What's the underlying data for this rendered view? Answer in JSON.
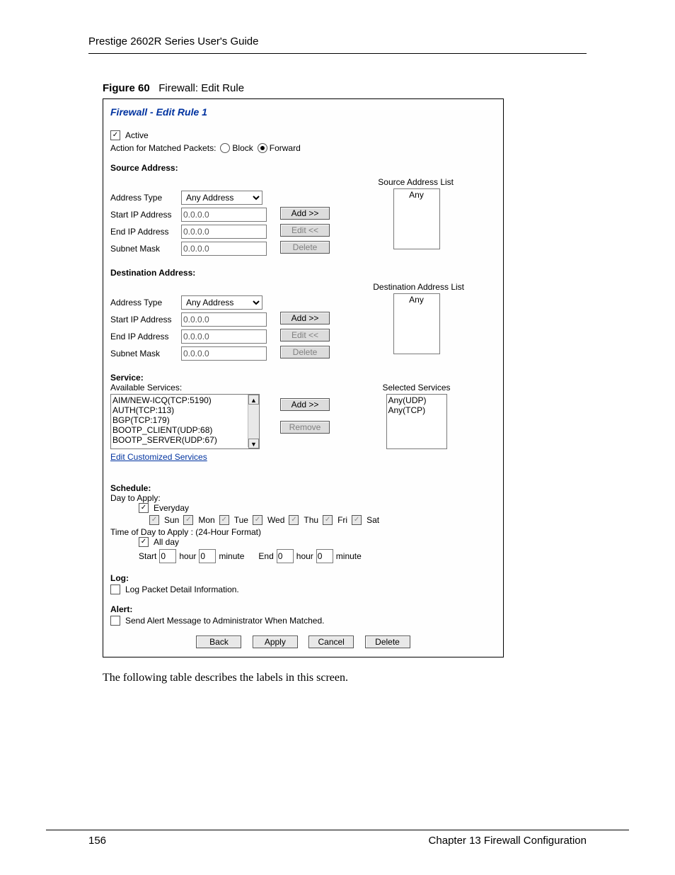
{
  "doc": {
    "header": "Prestige 2602R Series User's Guide",
    "figure_num": "Figure 60",
    "figure_title": "Firewall: Edit Rule",
    "following_text": "The following table describes the labels in this screen.",
    "page_number": "156",
    "chapter": "Chapter 13 Firewall Configuration"
  },
  "panel": {
    "title": "Firewall - Edit Rule 1",
    "active_label": "Active",
    "action_label": "Action for Matched Packets:",
    "block_label": "Block",
    "forward_label": "Forward"
  },
  "source": {
    "heading": "Source Address:",
    "list_label": "Source Address List",
    "type_label": "Address Type",
    "type_value": "Any Address",
    "start_label": "Start IP Address",
    "start_value": "0.0.0.0",
    "end_label": "End IP Address",
    "end_value": "0.0.0.0",
    "mask_label": "Subnet Mask",
    "mask_value": "0.0.0.0",
    "list_item": "Any"
  },
  "dest": {
    "heading": "Destination Address:",
    "list_label": "Destination Address List",
    "type_label": "Address Type",
    "type_value": "Any Address",
    "start_label": "Start IP Address",
    "start_value": "0.0.0.0",
    "end_label": "End IP Address",
    "end_value": "0.0.0.0",
    "mask_label": "Subnet Mask",
    "mask_value": "0.0.0.0",
    "list_item": "Any"
  },
  "buttons": {
    "add": "Add >>",
    "edit": "Edit <<",
    "delete": "Delete",
    "remove": "Remove",
    "back": "Back",
    "apply": "Apply",
    "cancel": "Cancel"
  },
  "service": {
    "heading": "Service:",
    "avail_label": "Available Services:",
    "selected_label": "Selected Services",
    "avail_items": [
      "AIM/NEW-ICQ(TCP:5190)",
      "AUTH(TCP:113)",
      "BGP(TCP:179)",
      "BOOTP_CLIENT(UDP:68)",
      "BOOTP_SERVER(UDP:67)"
    ],
    "selected_items": [
      "Any(UDP)",
      "Any(TCP)"
    ],
    "custom_link": "Edit Customized Services"
  },
  "schedule": {
    "heading": "Schedule:",
    "day_label": "Day to Apply:",
    "everyday": "Everyday",
    "days": [
      "Sun",
      "Mon",
      "Tue",
      "Wed",
      "Thu",
      "Fri",
      "Sat"
    ],
    "time_label": "Time of Day to Apply : (24-Hour Format)",
    "allday": "All day",
    "start": "Start",
    "end": "End",
    "hour": "hour",
    "minute": "minute",
    "zero": "0"
  },
  "log": {
    "heading": "Log:",
    "label": "Log Packet Detail Information."
  },
  "alert": {
    "heading": "Alert:",
    "label": "Send Alert Message to Administrator When Matched."
  }
}
